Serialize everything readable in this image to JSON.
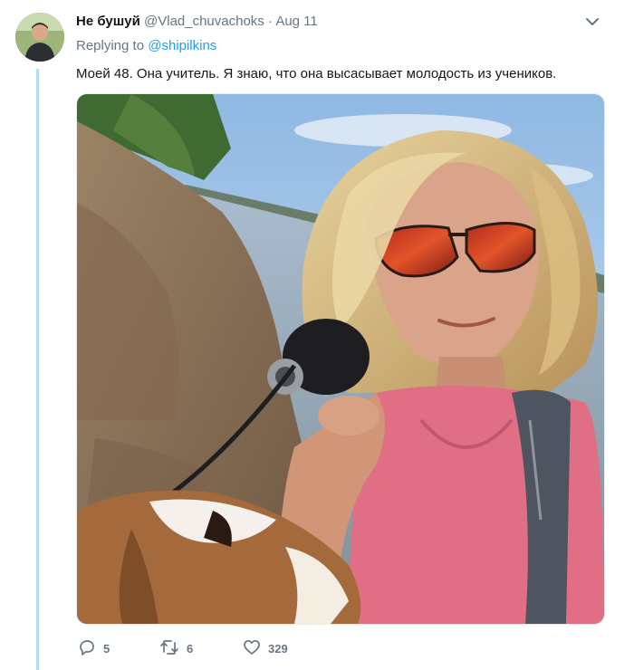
{
  "author": {
    "display_name": "Не бушуй",
    "handle": "@Vlad_chuvachoks",
    "separator": "·",
    "date": "Aug 11"
  },
  "reply_context": {
    "prefix": "Replying to",
    "mention": "@shipilkins"
  },
  "tweet": {
    "text": "Моей 48. Она учитель. Я знаю, что она высасывает молодость из учеников."
  },
  "actions": {
    "reply_count": "5",
    "retweet_count": "6",
    "like_count": "329"
  },
  "colors": {
    "accent": "#1da1f2",
    "secondary_text": "#657786",
    "primary_text": "#14171a",
    "thread_line": "#b3dcf5"
  },
  "icons": [
    "chevron-down-icon",
    "reply-icon",
    "retweet-icon",
    "heart-icon"
  ]
}
